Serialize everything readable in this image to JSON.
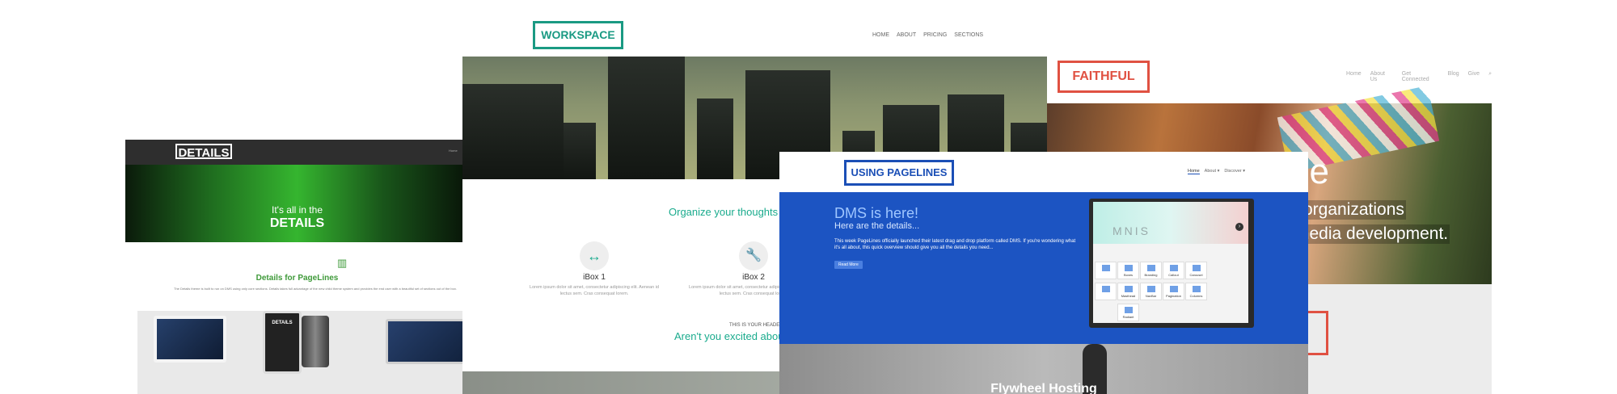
{
  "details": {
    "logo": "DETAILS",
    "nav_link": "Home",
    "hero_line1": "It's all in the",
    "hero_line2": "DETAILS",
    "chart_icon": "bar-chart-icon",
    "title": "Details for PageLines",
    "description": "The Details theme is built to run on DMS using only core sections. Details takes full advantage of the new child theme system and provides the end user with a beautiful set of sections out of the box.",
    "device_label": "DETAILS"
  },
  "workspace": {
    "logo": "WORKSPACE",
    "nav": [
      "HOME",
      "ABOUT",
      "PRICING",
      "SECTIONS"
    ],
    "tagline": "Organize your thoughts and",
    "ibox1": {
      "icon": "arrows-horizontal-icon",
      "title": "iBox 1",
      "text": "Lorem ipsum dolor sit amet, consectetur adipiscing elit. Aenean id lectus sem. Cras consequat lorem."
    },
    "ibox2": {
      "icon": "wrench-icon",
      "title": "iBox 2",
      "text": "Lorem ipsum dolor sit amet, consectetur adipiscing elit. Aenean id lectus sem. Cras consequat lorem."
    },
    "header_label": "THIS IS YOUR HEADER",
    "excited": "Aren't you excited about y"
  },
  "faithful": {
    "logo": "FAITHFUL",
    "nav": [
      "Home",
      "About Us",
      "Get Connected",
      "Blog",
      "Give"
    ],
    "search_icon": "search-icon",
    "hero_big": "ne",
    "hero_line1": "organizations",
    "hero_line2": "media development."
  },
  "pagelines": {
    "logo": "USING PAGELINES",
    "nav": [
      "Home",
      "About ▾",
      "Discover ▾"
    ],
    "headline": "DMS is here!",
    "subhead": "Here are the details...",
    "paragraph": "This week PageLines officially launched their latest drag and drop platform called DMS. If you're wondering what it's all about, this quick overview should give you all the details you need...",
    "button": "Read More",
    "banner_text": "MNIS",
    "arrow_icon": "chevron-right-icon",
    "tiles": [
      "Boxes",
      "Branding",
      "Callout",
      "Carousel",
      "Masthead",
      "NavBar",
      "Pagination",
      "Columns",
      "Radiant"
    ],
    "footer_title": "Flywheel Hosting"
  }
}
